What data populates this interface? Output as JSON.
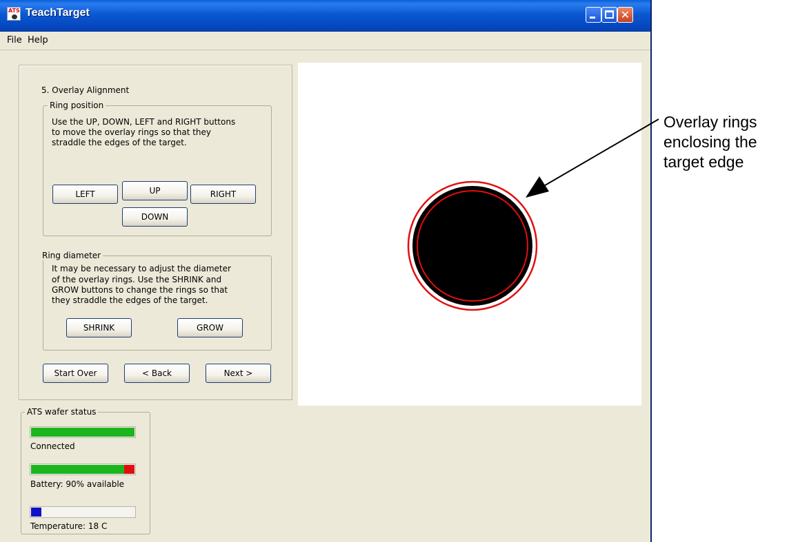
{
  "window": {
    "title": "TeachTarget",
    "app_icon_text": "ATS"
  },
  "menu": {
    "file": "File",
    "help": "Help"
  },
  "wizard": {
    "step_title": "5. Overlay Alignment",
    "ring_position": {
      "legend": "Ring position",
      "instructions_1": "Use the UP, DOWN, LEFT and RIGHT buttons",
      "instructions_2": "to move the overlay rings so that they",
      "instructions_3": "straddle the edges of the target.",
      "up": "UP",
      "down": "DOWN",
      "left": "LEFT",
      "right": "RIGHT"
    },
    "ring_diameter": {
      "legend": "Ring diameter",
      "instructions_1": "It may be necessary to adjust the diameter",
      "instructions_2": "of the overlay rings.  Use the SHRINK and",
      "instructions_3": "GROW buttons to change the rings so that",
      "instructions_4": "they straddle the edges of the target.",
      "shrink": "SHRINK",
      "grow": "GROW"
    },
    "nav": {
      "start_over": "Start Over",
      "back": "< Back",
      "next": "Next >"
    }
  },
  "status": {
    "legend": "ATS wafer status",
    "connection": {
      "label": "Connected",
      "level": 1.0,
      "color": "#1db51d"
    },
    "battery": {
      "label": "Battery: 90% available",
      "level": 0.9,
      "color": "#1db51d",
      "remainder_color": "#e01010"
    },
    "temperature": {
      "label": "Temperature: 18 C",
      "level": 0.1,
      "color": "#1010c8"
    }
  },
  "annotation": {
    "line_1": "Overlay rings",
    "line_2": "enclosing the",
    "line_3": "target edge"
  },
  "colors": {
    "ring": "#e01010",
    "target": "#000000"
  }
}
